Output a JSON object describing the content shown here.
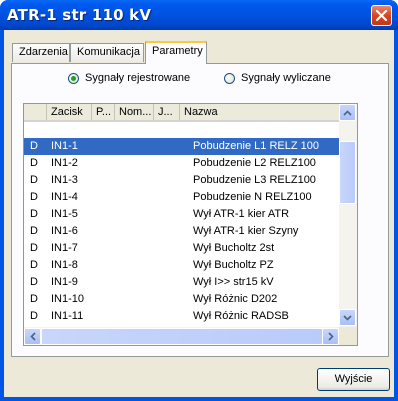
{
  "window": {
    "title": "ATR-1 str 110 kV"
  },
  "tabs": [
    {
      "label": "Zdarzenia"
    },
    {
      "label": "Komunikacja"
    },
    {
      "label": "Parametry"
    }
  ],
  "radios": {
    "registered": {
      "label": "Sygnały rejestrowane",
      "checked": true
    },
    "calculated": {
      "label": "Sygnały wyliczane",
      "checked": false
    }
  },
  "list": {
    "columns": [
      "",
      "Zacisk",
      "P...",
      "Nom...",
      "J...",
      "Nazwa"
    ],
    "rows": [
      {
        "type": "D",
        "terminal": "IN1-1",
        "name": "Pobudzenie L1 RELZ 100",
        "selected": true
      },
      {
        "type": "D",
        "terminal": "IN1-2",
        "name": "Pobudzenie L2 RELZ100"
      },
      {
        "type": "D",
        "terminal": "IN1-3",
        "name": "Pobudzenie L3 RELZ100"
      },
      {
        "type": "D",
        "terminal": "IN1-4",
        "name": "Pobudzenie N RELZ100"
      },
      {
        "type": "D",
        "terminal": "IN1-5",
        "name": "Wył ATR-1 kier ATR"
      },
      {
        "type": "D",
        "terminal": "IN1-6",
        "name": "Wył ATR-1 kier Szyny"
      },
      {
        "type": "D",
        "terminal": "IN1-7",
        "name": "Wył Bucholtz 2st"
      },
      {
        "type": "D",
        "terminal": "IN1-8",
        "name": "Wył Bucholtz PZ"
      },
      {
        "type": "D",
        "terminal": "IN1-9",
        "name": "Wył I>> str15 kV"
      },
      {
        "type": "D",
        "terminal": "IN1-10",
        "name": "Wył Różnic D202"
      },
      {
        "type": "D",
        "terminal": "IN1-11",
        "name": "Wył Różnic RADSB"
      }
    ]
  },
  "buttons": {
    "exit": "Wyjście"
  },
  "icons": {
    "close": "close-icon",
    "scroll_up": "arrow-up-icon",
    "scroll_down": "arrow-down-icon",
    "scroll_left": "arrow-left-icon",
    "scroll_right": "arrow-right-icon"
  },
  "colors": {
    "titlebar": "#0055e5",
    "selection": "#316ac5",
    "active_tab_accent": "#ffc83c",
    "close": "#d6451f"
  }
}
